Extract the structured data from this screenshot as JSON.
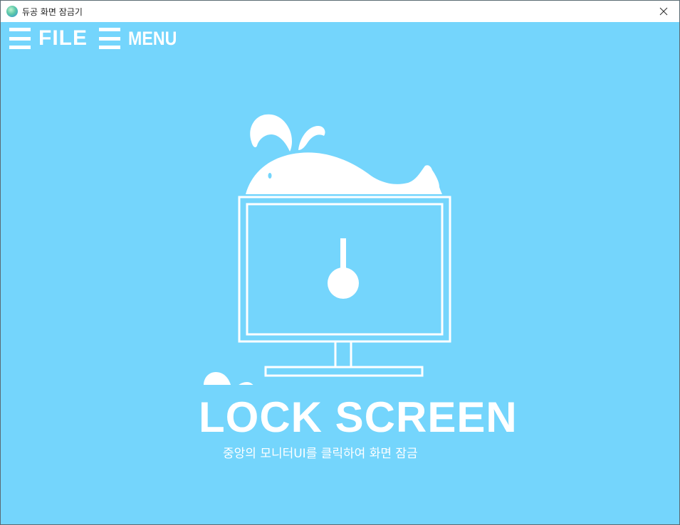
{
  "window": {
    "title": "듀공 화면 잠금기",
    "icon": "globe-app-icon",
    "close_icon": "close-icon",
    "background_color": "#74d5fc"
  },
  "menu": {
    "file_label": "FILE",
    "menu_label": "MENU",
    "icon": "hamburger-icon"
  },
  "main": {
    "title": "LOCK SCREEN",
    "subtitle": "중앙의 모니터UI를 클릭하여 화면 잠금",
    "artwork_icons": [
      "whale-icon",
      "monitor-icon",
      "keyhole-icon",
      "water-splash-icon"
    ]
  }
}
